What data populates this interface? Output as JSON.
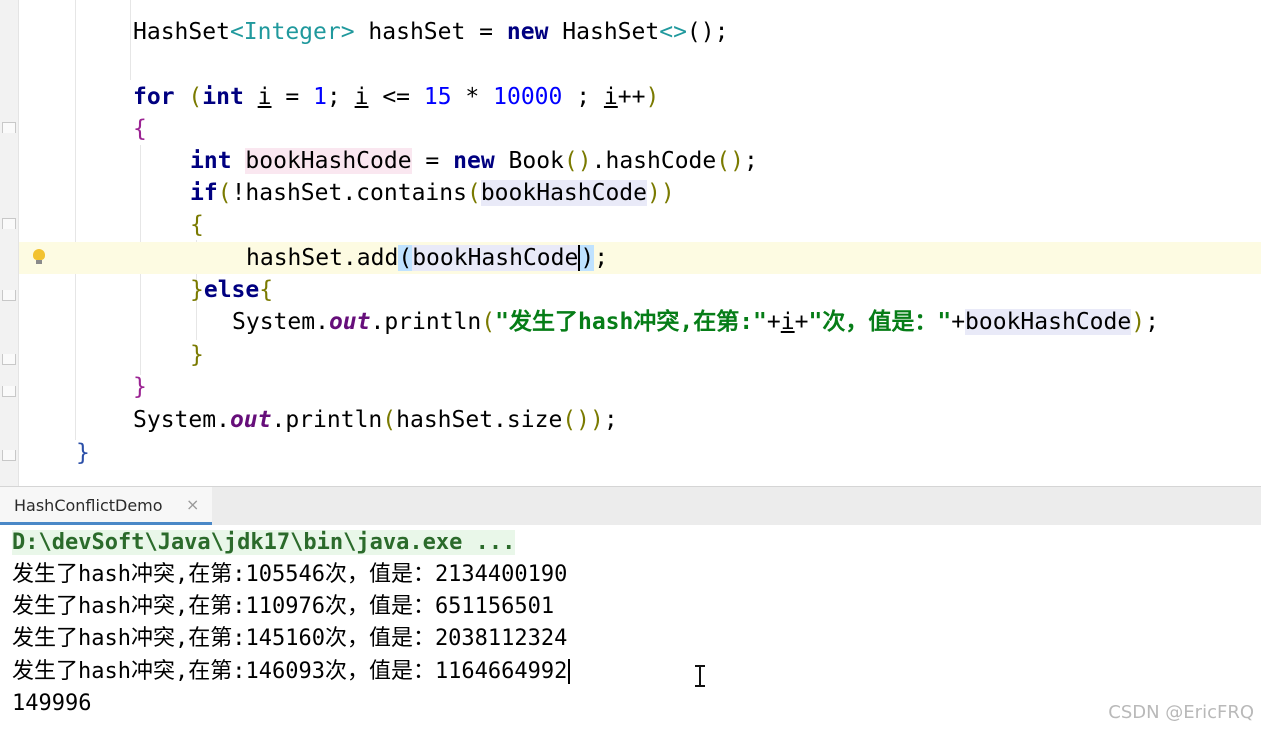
{
  "editor": {
    "line1": {
      "type1": "HashSet",
      "generic1": "<Integer>",
      "var": " hashSet = ",
      "kw_new": "new",
      "type2": " HashSet",
      "generic2": "<>",
      "end": "();"
    },
    "line2": {
      "kw_for": "for",
      "p_open": " (",
      "kw_int": "int",
      "sp1": " ",
      "i1": "i",
      "eq": " = ",
      "n1": "1",
      "semi1": "; ",
      "i2": "i",
      "le": " <= ",
      "n15": "15",
      "mul": " * ",
      "n10000": "10000",
      "semi2": " ; ",
      "i3": "i",
      "inc": "++",
      "p_close": ")"
    },
    "line3": {
      "brace": "{"
    },
    "line4": {
      "kw_int": "int",
      "sp": " ",
      "var": "bookHashCode",
      "eq": " = ",
      "kw_new": "new",
      "call": " Book",
      "p1": "()",
      "dot": ".hashCode",
      "p2": "()",
      "semi": ";"
    },
    "line5": {
      "kw_if": "if",
      "po": "(",
      "mid": "!hashSet.contains",
      "pi": "(",
      "arg": "bookHashCode",
      "pc": "))"
    },
    "line6": {
      "brace": "{"
    },
    "line7": {
      "call": "hashSet.add",
      "po": "(",
      "arg": "bookHashCode",
      "pc": ")",
      "semi": ";"
    },
    "line8": {
      "brace": "}",
      "kw_else": "else",
      "brace2": "{"
    },
    "line9": {
      "sys": "System.",
      "out": "out",
      "println": ".println",
      "po": "(",
      "str1": "\"发生了hash冲突,在第:\"",
      "plus1": "+",
      "i": "i",
      "plus2": "+",
      "str2": "\"次，值是：\"",
      "plus3": "+",
      "arg": "bookHashCode",
      "pc": ")",
      "semi": ";"
    },
    "line10": {
      "brace": "}"
    },
    "line11": {
      "brace": "}"
    },
    "line12": {
      "sys": "System.",
      "out": "out",
      "println": ".println",
      "po": "(",
      "mid": "hashSet.size",
      "pi": "()",
      "pc": ")",
      "semi": ";"
    },
    "line13": {
      "brace": "}"
    }
  },
  "run_tab": {
    "label": "HashConflictDemo",
    "close": "×"
  },
  "console": {
    "command": "D:\\devSoft\\Java\\jdk17\\bin\\java.exe ...",
    "lines": [
      "发生了hash冲突,在第:105546次，值是：2134400190",
      "发生了hash冲突,在第:110976次，值是：651156501",
      "发生了hash冲突,在第:145160次，值是：2038112324",
      "发生了hash冲突,在第:146093次，值是：1164664992"
    ],
    "result": "149996"
  },
  "watermark": "CSDN @EricFRQ"
}
